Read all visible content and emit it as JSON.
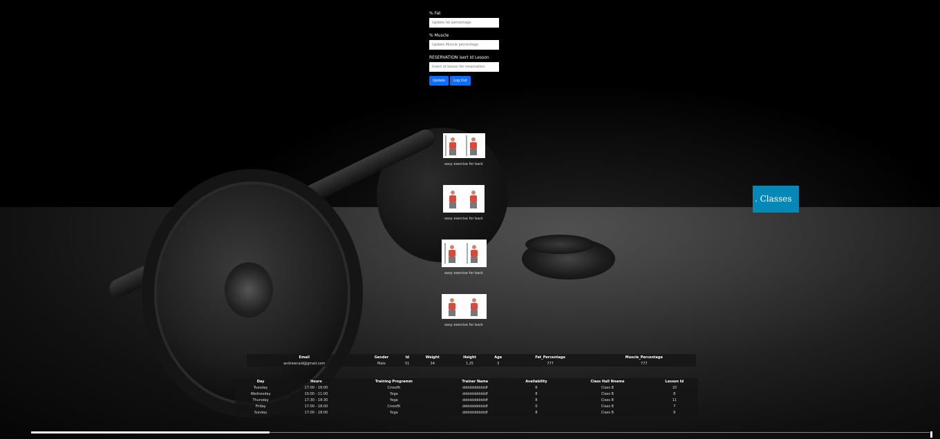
{
  "form": {
    "fat_label": "% Fat",
    "fat_placeholder": "Update fat percentage",
    "muscle_label": "% Muscle",
    "muscle_placeholder": "Update Muscle percentage",
    "reservation_label": "RESERVATION isert Id Lesson",
    "reservation_placeholder": "Insert id lesson for reservation",
    "update_label": "Update",
    "logout_label": "Log Out"
  },
  "exercises": [
    {
      "caption": "easy exercise for back"
    },
    {
      "caption": "easy exercise for back"
    },
    {
      "caption": "easy exercise for back"
    },
    {
      "caption": "easy exercise for back"
    }
  ],
  "classes_button": ". Classes",
  "profile_table": {
    "headers": [
      "Email",
      "Gender",
      "Id",
      "Weight",
      "Height",
      "Age",
      "Fat_Percentage",
      "Muscle_Percentage"
    ],
    "row": [
      "andrewcaid@gmail.com",
      "Male",
      "51",
      "34",
      "1.25",
      "3",
      "777",
      "777"
    ]
  },
  "schedule_table": {
    "headers": [
      "Day",
      "Hours",
      "Training Programm",
      "Trainer Name",
      "Availability",
      "Class Hall Nname",
      "Lesson Id"
    ],
    "rows": [
      [
        "Tuesday",
        "17:00 - 18:00",
        "Crossfit",
        "dddddddddddf",
        "6",
        "Class B",
        "10"
      ],
      [
        "Wednesday",
        "10:00 - 11:00",
        "Yoga",
        "dddddddddddf",
        "8",
        "Class B",
        "8"
      ],
      [
        "Thursday",
        "17:30 - 18:30",
        "Yoga",
        "dddddddddddf",
        "8",
        "Class B",
        "11"
      ],
      [
        "Friday",
        "17:00 - 18:00",
        "Crossfit",
        "dddddddddddf",
        "0",
        "Class B",
        "7"
      ],
      [
        "Sunday",
        "17:00 - 18:00",
        "Yoga",
        "dddddddddddf",
        "8",
        "Class B",
        "9"
      ]
    ]
  }
}
